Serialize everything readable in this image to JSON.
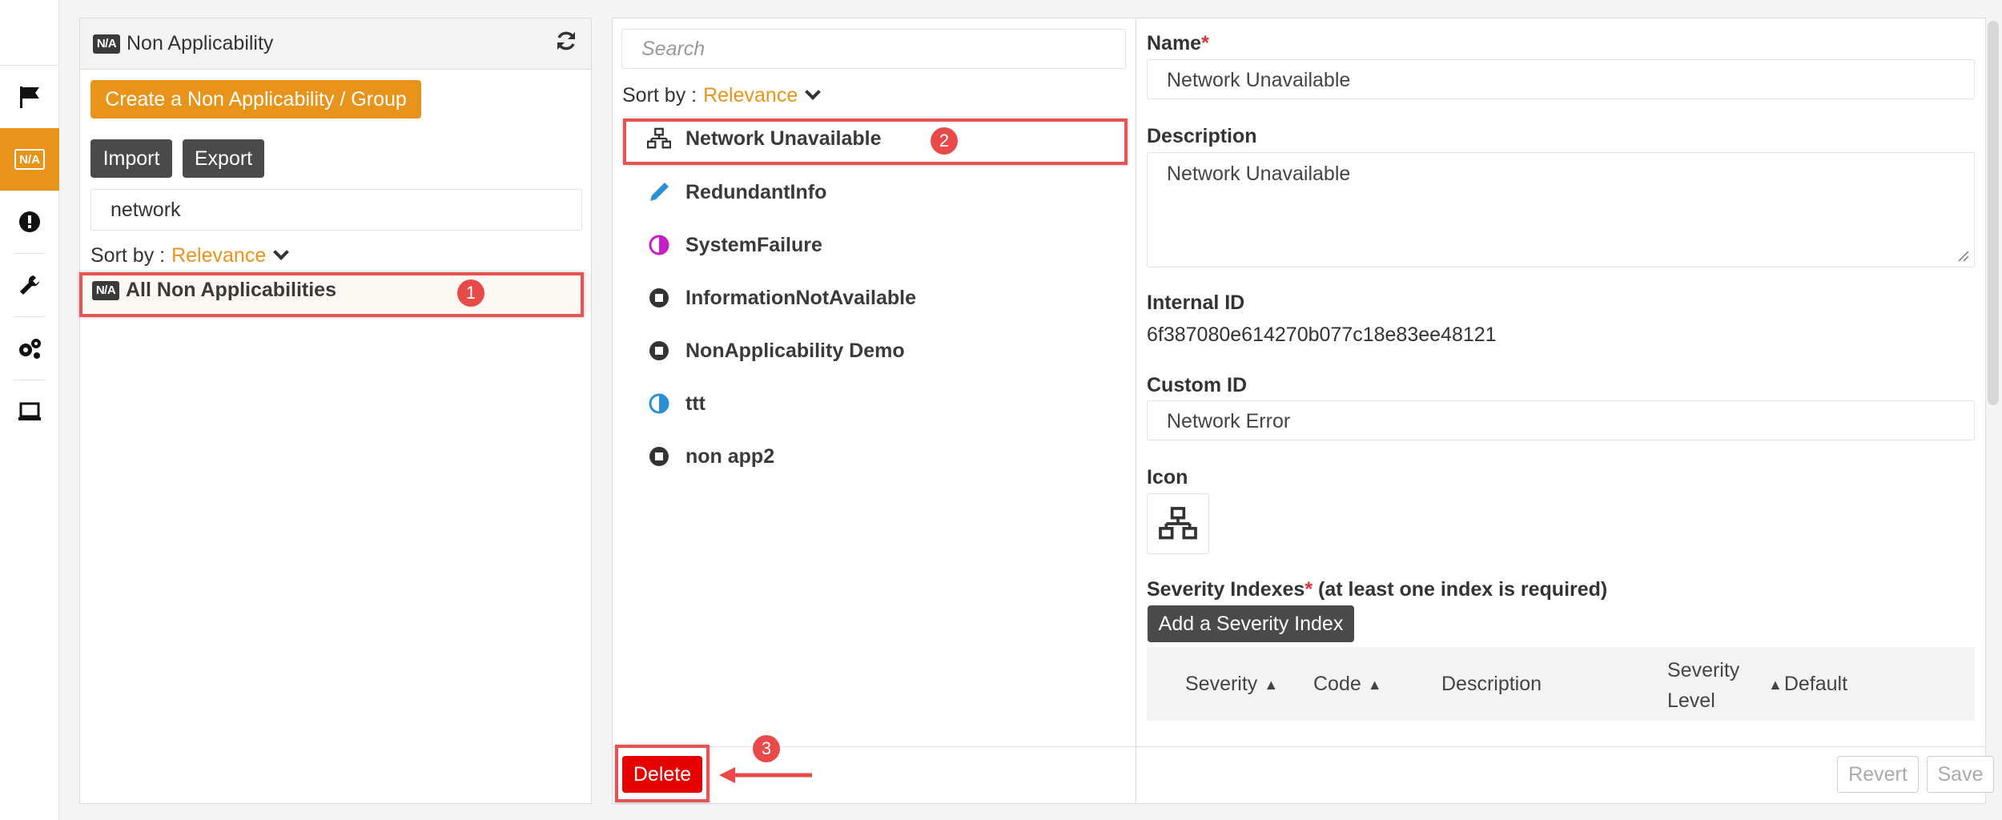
{
  "rail": {
    "items": [
      {
        "icon": "flag-icon",
        "active": false
      },
      {
        "icon": "na-icon",
        "label": "N/A",
        "active": true
      },
      {
        "icon": "alert-icon",
        "active": false
      },
      {
        "icon": "wrench-icon",
        "active": false
      },
      {
        "icon": "gears-icon",
        "active": false
      },
      {
        "icon": "laptop-icon",
        "active": false
      }
    ]
  },
  "left_panel": {
    "badge": "N/A",
    "title": "Non Applicability",
    "refresh_icon": "refresh-icon",
    "create_label": "Create a Non Applicability / Group",
    "import_label": "Import",
    "export_label": "Export",
    "search_value": "network",
    "sort_label": "Sort by :",
    "sort_value": "Relevance",
    "tree_item_badge": "N/A",
    "tree_item_label": "All Non Applicabilities",
    "callout": "1"
  },
  "middle_panel": {
    "search_placeholder": "Search",
    "sort_label": "Sort by :",
    "sort_value": "Relevance",
    "items": [
      {
        "label": "Network Unavailable",
        "icon": "network-icon"
      },
      {
        "label": "RedundantInfo",
        "icon": "pen-icon"
      },
      {
        "label": "SystemFailure",
        "icon": "half-circle-magenta-icon"
      },
      {
        "label": "InformationNotAvailable",
        "icon": "stop-circle-icon"
      },
      {
        "label": "NonApplicability Demo",
        "icon": "stop-circle-icon"
      },
      {
        "label": "ttt",
        "icon": "half-circle-blue-icon"
      },
      {
        "label": "non app2",
        "icon": "stop-circle-icon"
      }
    ],
    "callout": "2"
  },
  "detail": {
    "name_label": "Name",
    "name_value": "Network Unavailable",
    "description_label": "Description",
    "description_value": "Network Unavailable",
    "internal_id_label": "Internal ID",
    "internal_id_value": "6f387080e614270b077c18e83ee48121",
    "custom_id_label": "Custom ID",
    "custom_id_value": "Network Error",
    "icon_label": "Icon",
    "severity_label": "Severity Indexes",
    "severity_note": "(at least one index is required)",
    "add_severity_label": "Add a Severity Index",
    "table_headers": {
      "severity": "Severity",
      "code": "Code",
      "description": "Description",
      "severity_level_1": "Severity",
      "severity_level_2": "Level",
      "default": "Default"
    },
    "required_mark": "*"
  },
  "footer": {
    "delete_label": "Delete",
    "revert_label": "Revert",
    "save_label": "Save",
    "callout": "3"
  },
  "colors": {
    "accent": "#e8941a",
    "danger": "#e60000",
    "highlight": "#e55353",
    "dark_button": "#4a4a4a"
  }
}
